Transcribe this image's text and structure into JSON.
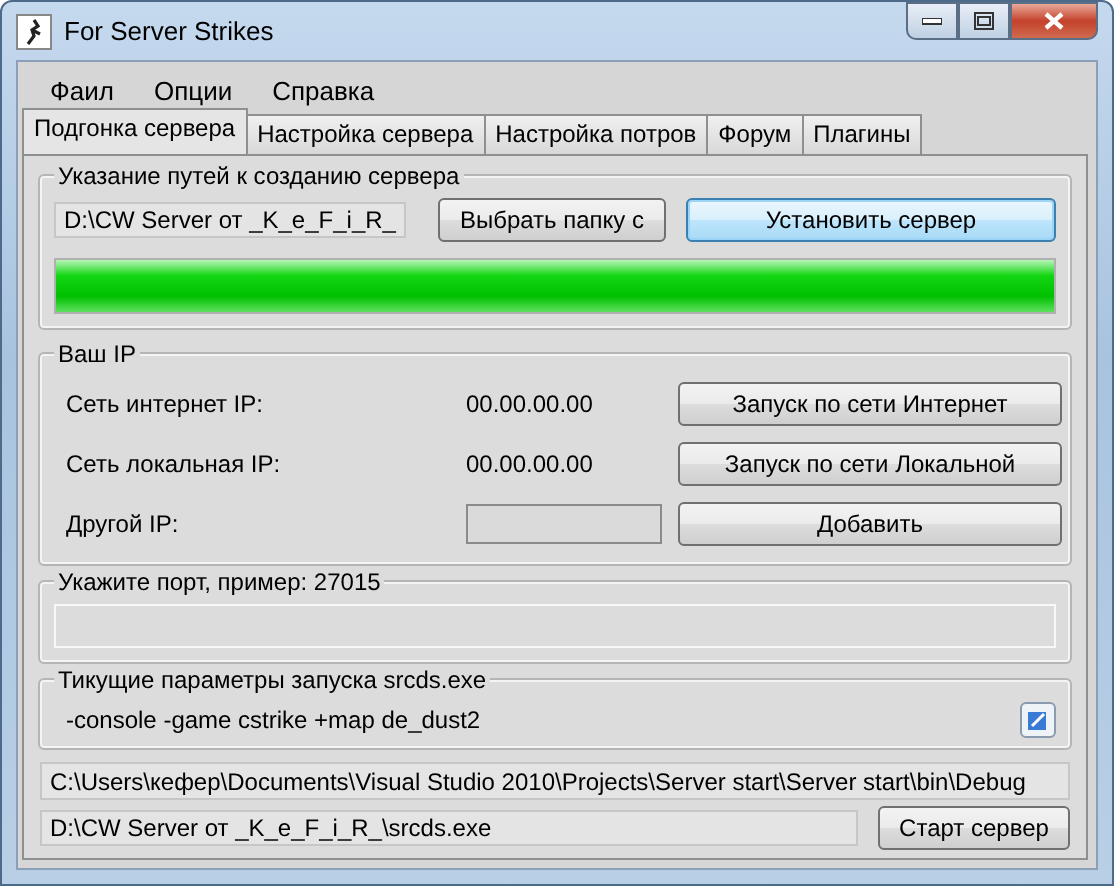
{
  "window": {
    "title": "For Server Strikes"
  },
  "menu": [
    {
      "label": "Фаил"
    },
    {
      "label": "Опции"
    },
    {
      "label": "Справка"
    }
  ],
  "tabs": [
    {
      "label": "Подгонка сервера",
      "selected": true
    },
    {
      "label": "Настройка сервера",
      "selected": false
    },
    {
      "label": "Настройка потров",
      "selected": false
    },
    {
      "label": "Форум",
      "selected": false
    },
    {
      "label": "Плагины",
      "selected": false
    }
  ],
  "paths_group": {
    "title": "Указание путей к созданию сервера",
    "path_field": {
      "value": "D:\\CW Server от _K_e_F_i_R_"
    },
    "browse_button": {
      "label": "Выбрать папку с",
      "focused": false
    },
    "install_button": {
      "label": "Установить сервер",
      "focused": true
    },
    "progress": {
      "level": 1
    }
  },
  "ip_group": {
    "title": "Ваш IP",
    "rows": [
      {
        "kind": "value",
        "label": "Сеть интернет IP:",
        "value": "00.00.00.00",
        "button": "Запуск по сети Интернет"
      },
      {
        "kind": "value",
        "label": "Сеть локальная IP:",
        "value": "00.00.00.00",
        "button": "Запуск по сети Локальной"
      },
      {
        "kind": "input",
        "label": "Другой IP:",
        "button": "Добавить"
      }
    ]
  },
  "port_group": {
    "title": "Укажите порт, пример: 27015"
  },
  "params_group": {
    "title": "Тикущие параметры запуска srcds.exe",
    "text": "-console -game cstrike +map de_dust2"
  },
  "working_dir": {
    "value": "C:\\Users\\кефер\\Documents\\Visual Studio 2010\\Projects\\Server start\\Server start\\bin\\Debug"
  },
  "exe_path": {
    "value": "D:\\CW Server от _K_e_F_i_R_\\srcds.exe"
  },
  "start_button": {
    "label": "Старт сервер",
    "focused": false
  }
}
